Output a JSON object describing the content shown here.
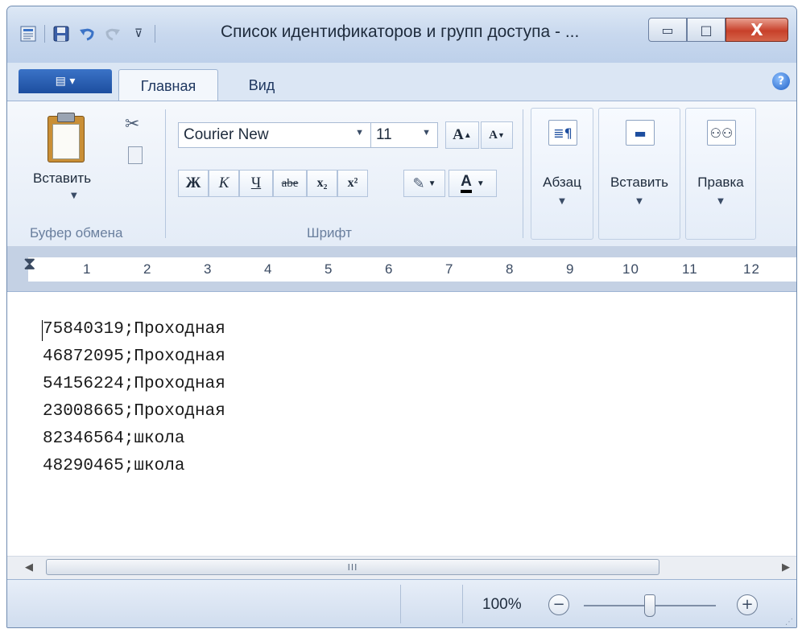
{
  "window": {
    "title": "Список идентификаторов и групп доступа - ...",
    "buttons": {
      "minimize": "▭",
      "maximize": "□",
      "close": "X"
    }
  },
  "quick_access": {
    "icons": [
      "app-icon",
      "save-icon",
      "undo-icon",
      "redo-icon",
      "customize-icon"
    ]
  },
  "ribbon": {
    "app_menu_label": "▤ ▾",
    "tabs": [
      {
        "label": "Главная",
        "active": true
      },
      {
        "label": "Вид",
        "active": false
      }
    ],
    "help_label": "?",
    "clipboard": {
      "paste_label": "Вставить",
      "group_label": "Буфер обмена"
    },
    "font": {
      "family": "Courier New",
      "size": "11",
      "bold": "Ж",
      "italic": "К",
      "underline": "Ч",
      "strike": "abe",
      "subscript": "x₂",
      "superscript": "x²",
      "grow": "A",
      "shrink": "A",
      "font_color": "A",
      "group_label": "Шрифт"
    },
    "paragraph_label": "Абзац",
    "insert_label": "Вставить",
    "editing_label": "Правка"
  },
  "ruler": {
    "marks": [
      "1",
      "2",
      "3",
      "4",
      "5",
      "6",
      "7",
      "8",
      "9",
      "10",
      "11",
      "12"
    ]
  },
  "document": {
    "lines": [
      "75840319;Проходная",
      "46872095;Проходная",
      "54156224;Проходная",
      "23008665;Проходная",
      "82346564;школа",
      "48290465;школа"
    ]
  },
  "scrollbar": {
    "thumb_grip": "III"
  },
  "statusbar": {
    "zoom": "100%",
    "zoom_level": 0.5,
    "zoom_out": "−",
    "zoom_in": "+"
  },
  "colors": {
    "window_frame": "#6f8bb0",
    "ribbon_bg": "#e4ecf7",
    "close_button": "#c8402a",
    "app_menu": "#1d4e9f"
  }
}
